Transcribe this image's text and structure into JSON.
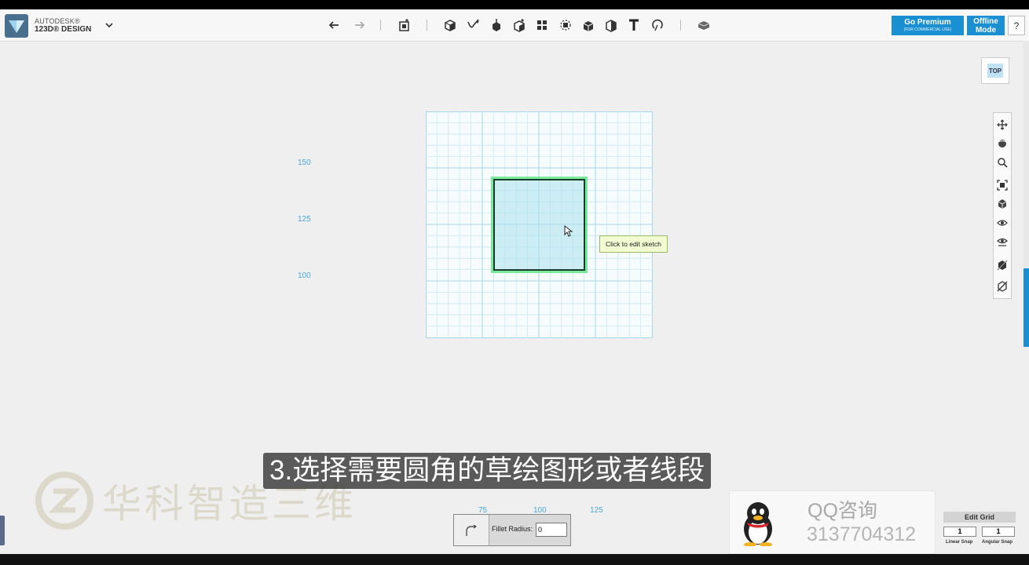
{
  "app": {
    "brand_line1": "AUTODESK®",
    "brand_line2": "123D® DESIGN"
  },
  "toolbar": {
    "icons": [
      "undo-icon",
      "redo-icon",
      "transform-icon",
      "primitives-icon",
      "sketch-icon",
      "construct-icon",
      "modify-icon",
      "pattern-icon",
      "grouping-icon",
      "combine-icon",
      "measure-icon",
      "text-icon",
      "snap-icon",
      "material-icon"
    ]
  },
  "header_buttons": {
    "premium_title": "Go Premium",
    "premium_sub": "(FOR COMMERCIAL USE)",
    "offline_line1": "Offline",
    "offline_line2": "Mode",
    "help": "?"
  },
  "viewcube": {
    "face": "TOP"
  },
  "nav_icons": [
    "pan-icon",
    "orbit-icon",
    "zoom-icon",
    "fit-icon",
    "view-cube-icon",
    "visibility-icon",
    "hide-icon",
    "material-shading-icon",
    "outline-icon"
  ],
  "grid": {
    "y_labels": [
      "150",
      "125",
      "100"
    ],
    "x_labels": [
      "75",
      "100",
      "125"
    ]
  },
  "tooltip": "Click to edit sketch",
  "watermark": "华科智造三维",
  "subtitle": "3.选择需要圆角的草绘图形或者线段",
  "fillet": {
    "label": "Fillet Radius:",
    "value": "0"
  },
  "qq": {
    "title": "QQ咨询",
    "number": "3137704312"
  },
  "edit_grid": {
    "title": "Edit Grid",
    "linear_value": "1",
    "angular_value": "1",
    "linear_label": "Linear Snap",
    "angular_label": "Angular Snap"
  },
  "colors": {
    "accent": "#1a8fd1",
    "grid_line": "#a9d6ec",
    "sketch_highlight": "#50e678"
  }
}
